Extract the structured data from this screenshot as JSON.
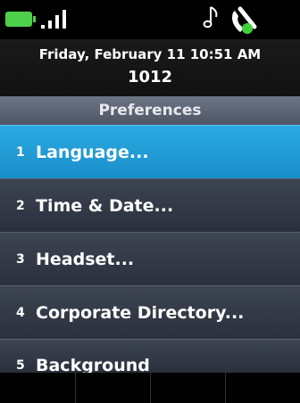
{
  "status": {
    "icons": [
      "battery-icon",
      "signal-icon",
      "music-note-icon",
      "handset-icon"
    ],
    "colors": {
      "battery": "#4fd04a",
      "accent": "#1a9ed8"
    }
  },
  "header": {
    "datetime": "Friday, February 11 10:51 AM",
    "extension": "1012"
  },
  "menu": {
    "title": "Preferences",
    "items": [
      {
        "num": "1",
        "label": "Language..."
      },
      {
        "num": "2",
        "label": "Time & Date..."
      },
      {
        "num": "3",
        "label": "Headset..."
      },
      {
        "num": "4",
        "label": "Corporate Directory..."
      },
      {
        "num": "5",
        "label": "Background"
      }
    ]
  },
  "softkeys": [
    "",
    "",
    "",
    ""
  ]
}
